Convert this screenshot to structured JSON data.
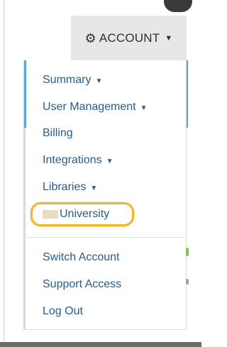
{
  "account_button": {
    "label": "ACCOUNT",
    "icon": "gear-icon",
    "caret_icon": "caret-down-icon"
  },
  "menu": {
    "items": [
      {
        "label": "Summary",
        "has_caret": true
      },
      {
        "label": "User Management",
        "has_caret": true
      },
      {
        "label": "Billing",
        "has_caret": false
      },
      {
        "label": "Integrations",
        "has_caret": true
      },
      {
        "label": "Libraries",
        "has_caret": true
      },
      {
        "label": "University",
        "highlighted": true
      },
      {
        "label": "Switch Account",
        "has_caret": false
      },
      {
        "label": "Support Access",
        "has_caret": false
      },
      {
        "label": "Log Out",
        "has_caret": false
      }
    ]
  },
  "colors": {
    "link": "#285c8e",
    "highlight": "#f3b61f",
    "accent": "#5aa8d8",
    "button_bg": "#e7e7e7"
  }
}
